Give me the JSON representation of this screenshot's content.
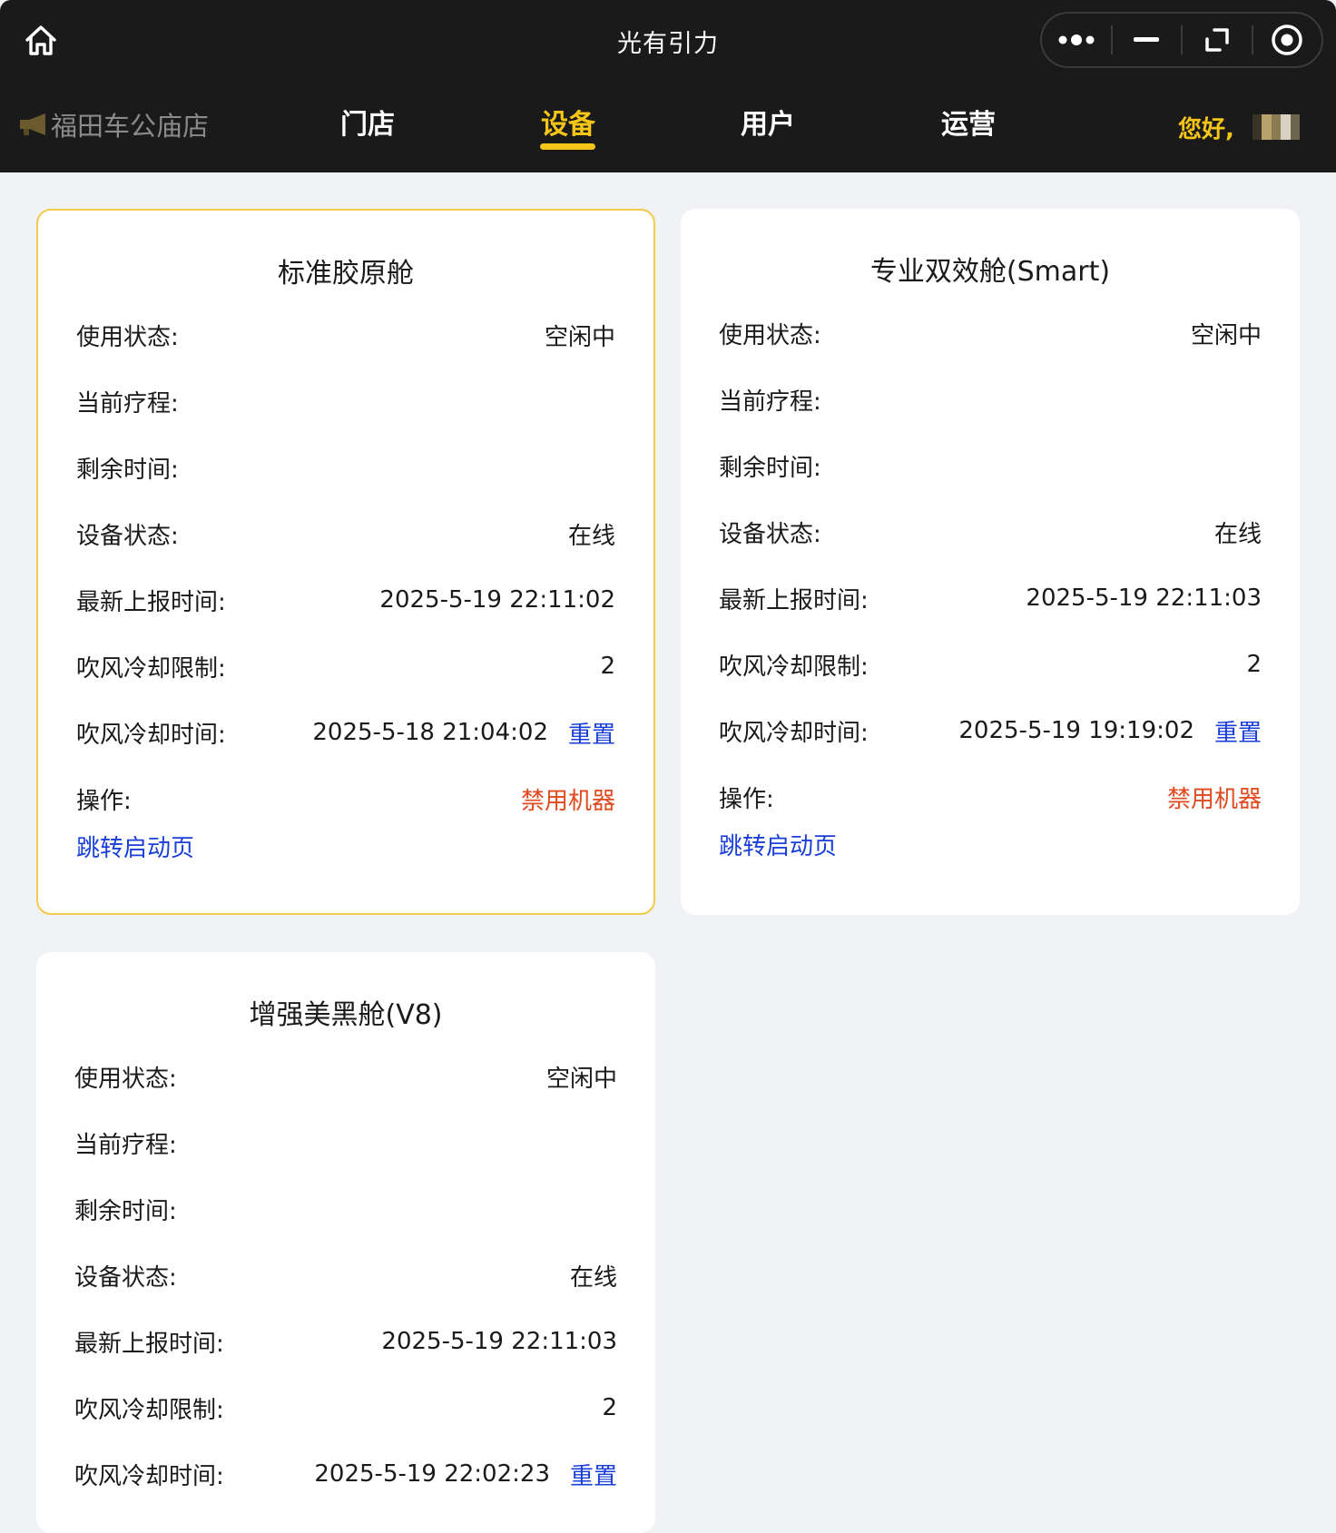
{
  "app": {
    "title": "光有引力",
    "home_icon": "home-icon",
    "capsule_icons": [
      "more-dots-icon",
      "minimize-icon",
      "expand-icon",
      "record-target-icon"
    ]
  },
  "nav": {
    "store_name": "福田车公庙店",
    "store_icon": "horn-icon",
    "tabs": [
      "门店",
      "设备",
      "用户",
      "运营"
    ],
    "active_tab": "设备",
    "greeting": "您好,",
    "accent_color": "#f5c518"
  },
  "labels": {
    "usage_status": "使用状态:",
    "current_course": "当前疗程:",
    "remaining_time": "剩余时间:",
    "device_status": "设备状态:",
    "last_report": "最新上报时间:",
    "cooling_limit": "吹风冷却限制:",
    "cooling_time": "吹风冷却时间:",
    "operation": "操作:",
    "reset": "重置",
    "disable": "禁用机器",
    "jump": "跳转启动页"
  },
  "devices": [
    {
      "name": "标准胶原舱",
      "usage_status": "空闲中",
      "current_course": "",
      "remaining_time": "",
      "device_status": "在线",
      "last_report": "2025-5-19 22:11:02",
      "cooling_limit": "2",
      "cooling_time": "2025-5-18 21:04:02"
    },
    {
      "name": "专业双效舱(Smart)",
      "usage_status": "空闲中",
      "current_course": "",
      "remaining_time": "",
      "device_status": "在线",
      "last_report": "2025-5-19 22:11:03",
      "cooling_limit": "2",
      "cooling_time": "2025-5-19 19:19:02"
    },
    {
      "name": "增强美黑舱(V8)",
      "usage_status": "空闲中",
      "current_course": "",
      "remaining_time": "",
      "device_status": "在线",
      "last_report": "2025-5-19 22:11:03",
      "cooling_limit": "2",
      "cooling_time": "2025-5-19 22:02:23"
    }
  ]
}
